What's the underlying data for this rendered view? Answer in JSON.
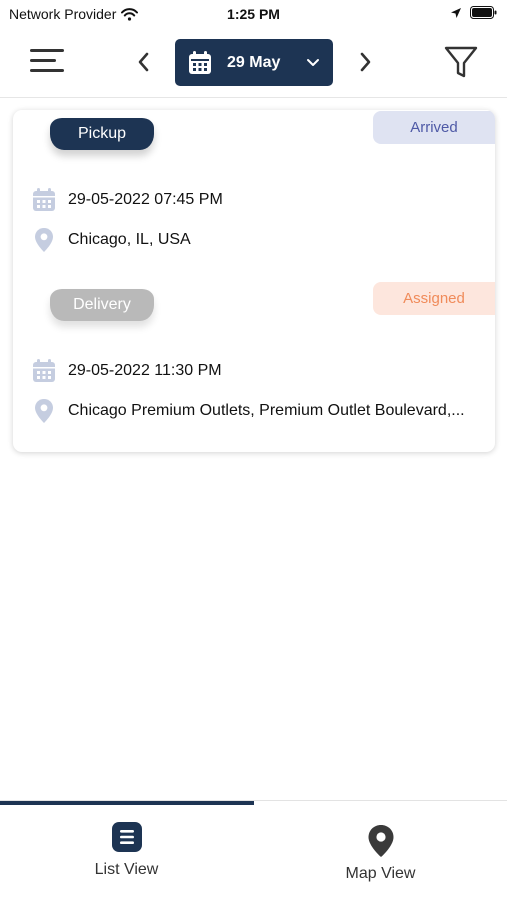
{
  "status_bar": {
    "carrier": "Network Provider",
    "time": "1:25 PM"
  },
  "header": {
    "date_label": "29 May"
  },
  "stops": [
    {
      "type_label": "Pickup",
      "status": "Arrived",
      "datetime": "29-05-2022 07:45 PM",
      "address": "Chicago, IL, USA"
    },
    {
      "type_label": "Delivery",
      "status": "Assigned",
      "datetime": "29-05-2022 11:30 PM",
      "address": "Chicago Premium Outlets, Premium Outlet Boulevard,..."
    }
  ],
  "tabs": [
    {
      "label": "List View",
      "icon": "list-icon",
      "active": true
    },
    {
      "label": "Map View",
      "icon": "map-pin-icon",
      "active": false
    }
  ],
  "colors": {
    "primary": "#1d3453",
    "arrived_bg": "#dfe3f2",
    "arrived_text": "#4e59a6",
    "assigned_bg": "#fde6dd",
    "assigned_text": "#f08b5a",
    "delivery_ribbon": "#b9b9b9"
  }
}
